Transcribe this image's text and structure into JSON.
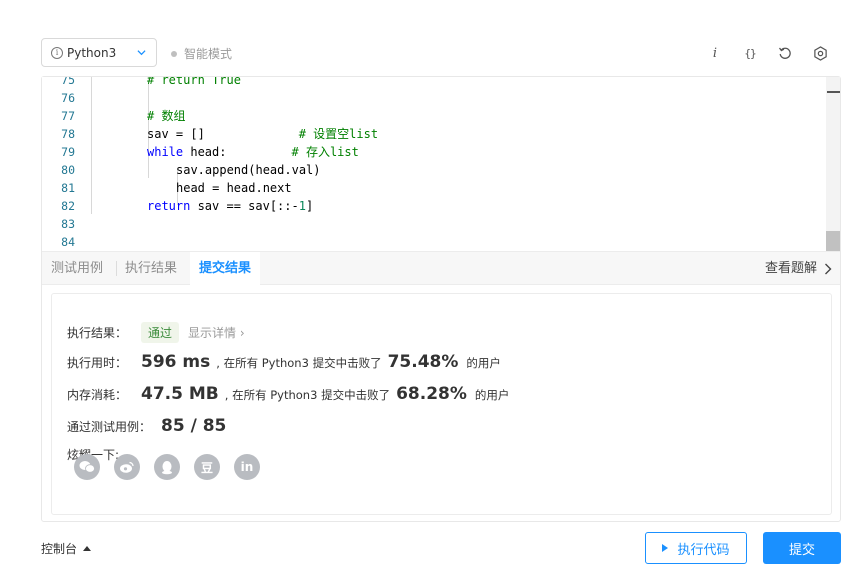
{
  "toolbar": {
    "language": "Python3",
    "smart_mode": "智能模式",
    "info_icon_text": "i",
    "braces_icon_text": "{}"
  },
  "editor": {
    "lines": [
      {
        "num": "75",
        "indent": 2,
        "parts": [
          {
            "t": "# return True",
            "c": "com"
          }
        ]
      },
      {
        "num": "76",
        "indent": 0,
        "parts": []
      },
      {
        "num": "77",
        "indent": 2,
        "parts": [
          {
            "t": "# 数组",
            "c": "com"
          }
        ]
      },
      {
        "num": "78",
        "indent": 2,
        "parts": [
          {
            "t": "sav = []             ",
            "c": "txt"
          },
          {
            "t": "# 设置空list",
            "c": "com"
          }
        ]
      },
      {
        "num": "79",
        "indent": 2,
        "parts": [
          {
            "t": "while",
            "c": "kw"
          },
          {
            "t": " head:         ",
            "c": "txt"
          },
          {
            "t": "# 存入list",
            "c": "com"
          }
        ]
      },
      {
        "num": "80",
        "indent": 3,
        "parts": [
          {
            "t": "sav.append(head.val)",
            "c": "txt"
          }
        ]
      },
      {
        "num": "81",
        "indent": 3,
        "parts": [
          {
            "t": "head = head.next",
            "c": "txt"
          }
        ]
      },
      {
        "num": "82",
        "indent": 2,
        "parts": [
          {
            "t": "return",
            "c": "kw"
          },
          {
            "t": " sav == sav[::-",
            "c": "txt"
          },
          {
            "t": "1",
            "c": "num"
          },
          {
            "t": "]",
            "c": "txt"
          }
        ]
      },
      {
        "num": "83",
        "indent": 0,
        "parts": []
      },
      {
        "num": "84",
        "indent": 0,
        "parts": []
      }
    ]
  },
  "tabs": {
    "test_cases": "测试用例",
    "run_result": "执行结果",
    "submit_result": "提交结果",
    "view_description": "查看题解"
  },
  "result": {
    "exec_result_label": "执行结果：",
    "status": "通过",
    "show_details": "显示详情 ›",
    "runtime_label": "执行用时：",
    "runtime_value": "596 ms",
    "runtime_text": ", 在所有 Python3 提交中击败了",
    "runtime_pct": "75.48%",
    "runtime_after": "的用户",
    "memory_label": "内存消耗：",
    "memory_value": "47.5 MB",
    "memory_text": ", 在所有 Python3 提交中击败了",
    "memory_pct": "68.28%",
    "memory_after": "的用户",
    "tests_label": "通过测试用例：",
    "tests_value": "85 / 85",
    "share_label": "炫耀一下:",
    "share_icons": [
      {
        "name": "wechat-icon",
        "glyph": ""
      },
      {
        "name": "weibo-icon",
        "glyph": ""
      },
      {
        "name": "qq-icon",
        "glyph": ""
      },
      {
        "name": "douban-icon",
        "glyph": "豆"
      },
      {
        "name": "linkedin-icon",
        "glyph": "in"
      }
    ]
  },
  "bottom": {
    "console": "控制台",
    "run_code": "执行代码",
    "submit": "提交"
  }
}
